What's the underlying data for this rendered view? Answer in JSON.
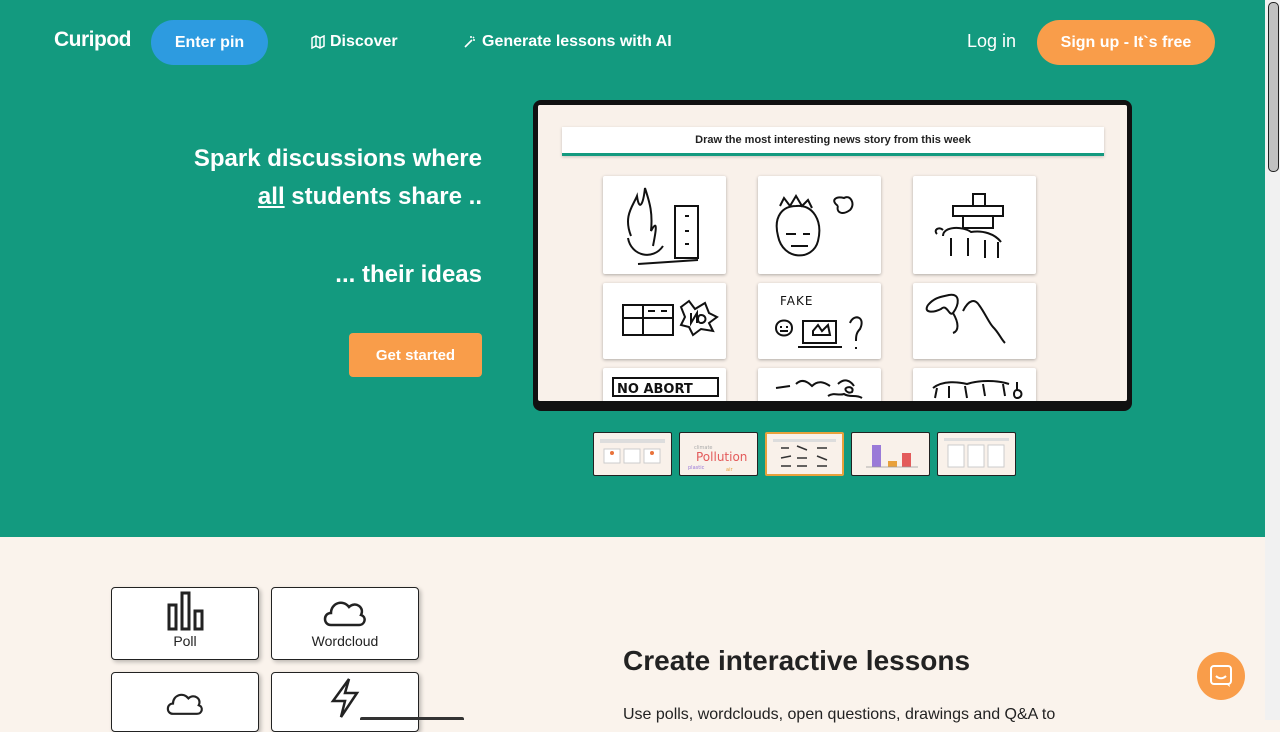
{
  "nav": {
    "logo": "Curipod",
    "enter_pin": "Enter pin",
    "discover": "Discover",
    "generate": "Generate lessons with AI",
    "login": "Log in",
    "signup": "Sign up - It`s free"
  },
  "hero": {
    "line1": "Spark discussions where",
    "line2_underlined": "all",
    "line2_rest": " students share ..",
    "line3": "... their ideas",
    "cta": "Get started"
  },
  "slide": {
    "prompt": "Draw the most interesting news story from this week",
    "thumb_word": "Pollution"
  },
  "tiles": [
    "Poll",
    "Wordcloud"
  ],
  "section": {
    "title": "Create interactive lessons",
    "text": "Use polls, wordclouds, open questions, drawings and Q&A to"
  },
  "colors": {
    "teal": "#139a7f",
    "orange": "#f99d4a",
    "blue": "#2d9be0",
    "cream": "#faf3ec"
  }
}
